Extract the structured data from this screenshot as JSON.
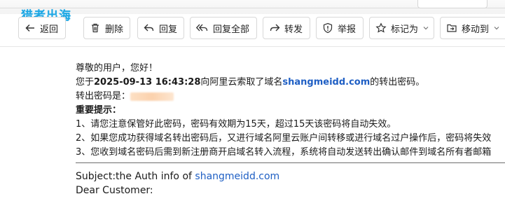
{
  "logo_text": "猎者出海",
  "toolbar": {
    "back": "返回",
    "delete": "删除",
    "reply": "回复",
    "reply_all": "回复全部",
    "forward": "转发",
    "report": "举报",
    "mark_as": "标记为",
    "move_to": "移动到"
  },
  "email": {
    "greeting": "尊敬的用户，您好！",
    "line1_prefix": "您于",
    "datetime": "2025-09-13 16:43:28",
    "line1_middle": "向阿里云索取了域名",
    "domain": "shangmeidd.com",
    "line1_suffix": "的转出密码。",
    "code_label": "转出密码是：",
    "notice_title": "重要提示：",
    "notices": [
      "1、请您注意保管好此密码，密码有效期为15天，超过15天该密码将自动失效。",
      "2、如果您成功获得域名转出密码后，又进行域名阿里云账户间转移或进行域名过户操作后，密码将失效",
      "3、您收到域名密码后需到新注册商开启域名转入流程，系统将自动发送转出确认邮件到域名所有者邮箱"
    ],
    "subject_prefix": "Subject:the Auth info of ",
    "subject_domain": "shangmeidd.com",
    "dear": "Dear Customer:"
  }
}
